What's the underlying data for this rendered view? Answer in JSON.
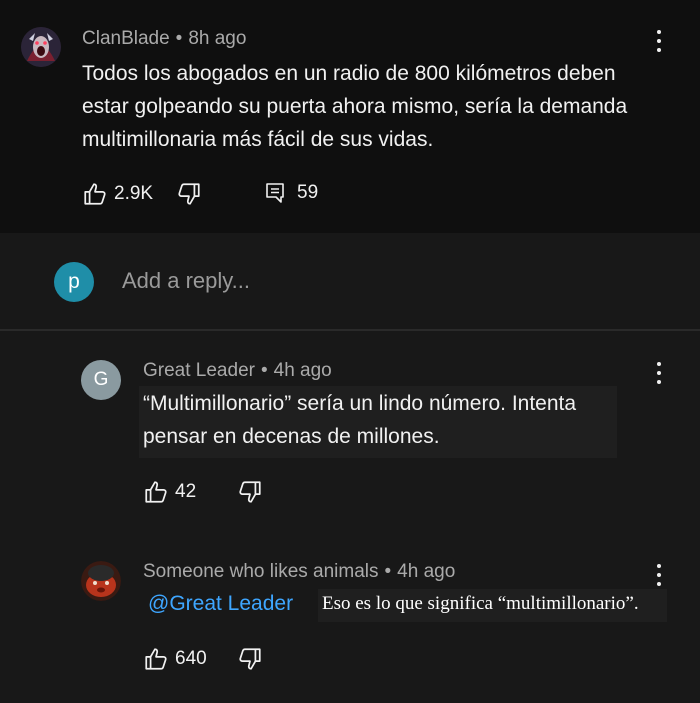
{
  "top_comment": {
    "author": "ClanBlade",
    "separator": "•",
    "time": "8h ago",
    "text_lines": [
      "Todos los abogados en un radio de 800 kilómetros deben",
      "estar golpeando su puerta ahora mismo, sería la demanda",
      "multimillonaria más fácil de sus vidas."
    ],
    "likes": "2.9K",
    "replies": "59"
  },
  "reply_box": {
    "avatar_letter": "p",
    "placeholder": "Add a reply..."
  },
  "replies": [
    {
      "avatar_letter": "G",
      "author": "Great Leader",
      "separator": "•",
      "time": "4h ago",
      "text_lines": [
        "“Multimillonario” sería un lindo número. Intenta",
        "pensar en decenas de millones."
      ],
      "likes": "42"
    },
    {
      "author": "Someone who likes animals",
      "separator": "•",
      "time": "4h ago",
      "mention": "@Great Leader",
      "text": "Eso es lo que significa “multimillonario”.",
      "likes": "640"
    }
  ],
  "colors": {
    "background": "#181818",
    "top_background": "#0f0f0f",
    "mention": "#3ea6ff",
    "reply_avatar": "#1f8ea8",
    "g_avatar": "#8a9aa0"
  }
}
